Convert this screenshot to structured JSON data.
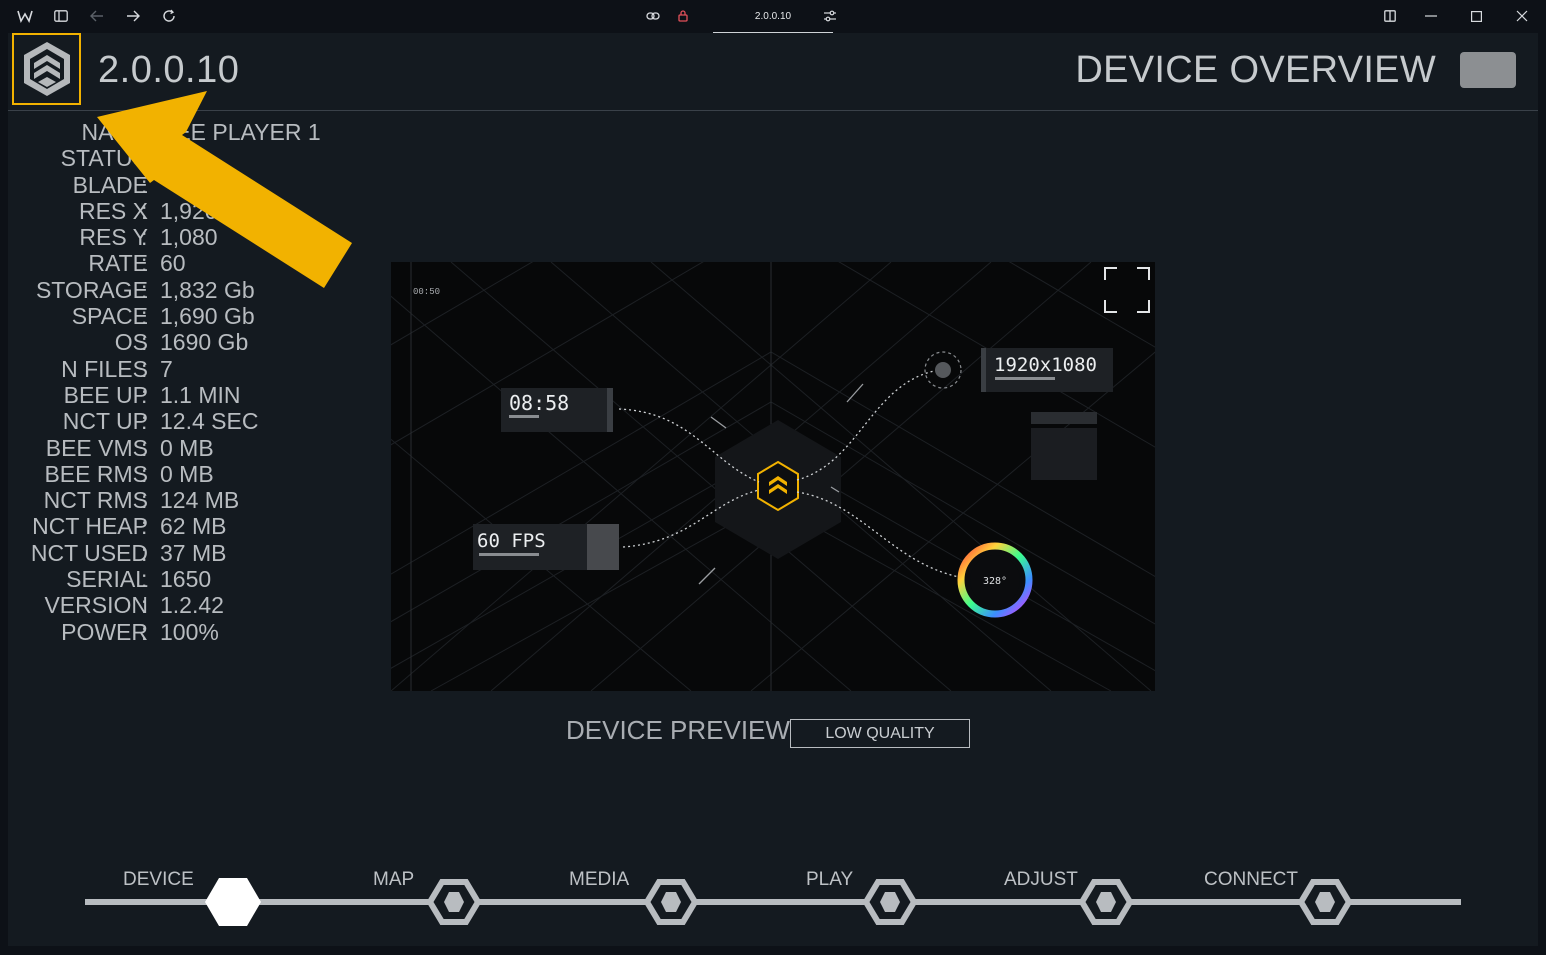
{
  "browser": {
    "tab_title": "2.0.0.10"
  },
  "header": {
    "version": "2.0.0.10",
    "page_title": "DEVICE OVERVIEW"
  },
  "info": [
    {
      "key": "NAME",
      "value": "BEE PLAYER 1"
    },
    {
      "key": "STATUS",
      "value": ""
    },
    {
      "key": "BLADE",
      "value": ""
    },
    {
      "key": "RES X",
      "value": "1,920"
    },
    {
      "key": "RES Y",
      "value": "1,080"
    },
    {
      "key": "RATE",
      "value": "60"
    },
    {
      "key": "STORAGE",
      "value": "1,832 Gb"
    },
    {
      "key": "SPACE",
      "value": "1,690 Gb"
    },
    {
      "key": "OS",
      "value": "1690 Gb"
    },
    {
      "key": "N FILES",
      "value": "7"
    },
    {
      "key": "BEE UP",
      "value": "1.1 MIN"
    },
    {
      "key": "NCT UP",
      "value": "12.4 SEC"
    },
    {
      "key": "BEE VMS",
      "value": "0 MB"
    },
    {
      "key": "BEE RMS",
      "value": "0 MB"
    },
    {
      "key": "NCT RMS",
      "value": "124 MB"
    },
    {
      "key": "NCT HEAP",
      "value": "62 MB"
    },
    {
      "key": "NCT USED",
      "value": "37 MB"
    },
    {
      "key": "SERIAL",
      "value": "1650"
    },
    {
      "key": "VERSION",
      "value": "1.2.42"
    },
    {
      "key": "POWER",
      "value": "100%"
    }
  ],
  "preview": {
    "label": "DEVICE PREVIEW",
    "quality_button": "LOW QUALITY",
    "time": "08:58",
    "fps": "60 FPS",
    "resolution": "1920x1080",
    "hue": "328°"
  },
  "nav": [
    {
      "label": "DEVICE",
      "active": true
    },
    {
      "label": "MAP",
      "active": false
    },
    {
      "label": "MEDIA",
      "active": false
    },
    {
      "label": "PLAY",
      "active": false
    },
    {
      "label": "ADJUST",
      "active": false
    },
    {
      "label": "CONNECT",
      "active": false
    }
  ],
  "colors": {
    "accent": "#f2b200",
    "text": "#b8bcc0",
    "background": "#141a20"
  }
}
